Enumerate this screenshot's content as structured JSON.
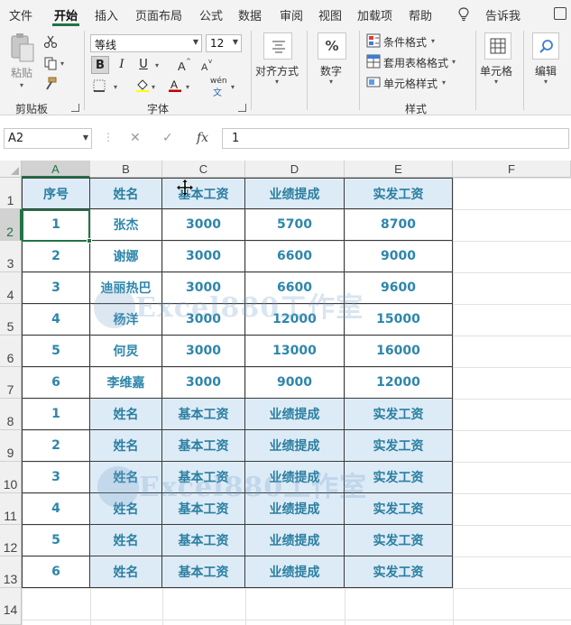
{
  "ribbon_tabs": [
    "文件",
    "开始",
    "插入",
    "页面布局",
    "公式",
    "数据",
    "审阅",
    "视图",
    "加载项",
    "帮助"
  ],
  "tell_me": "告诉我",
  "clipboard": {
    "paste_label": "粘贴",
    "group_label": "剪贴板"
  },
  "font": {
    "name": "等线",
    "size": "12",
    "group_label": "字体",
    "bold": "B",
    "italic": "I",
    "underline": "U",
    "phonetic": "wén"
  },
  "alignment": {
    "label": "对齐方式"
  },
  "number": {
    "label": "数字",
    "symbol": "%"
  },
  "styles": {
    "conditional": "条件格式",
    "table": "套用表格格式",
    "cell_styles": "单元格样式",
    "group_label": "样式"
  },
  "cells": {
    "label": "单元格"
  },
  "editing": {
    "label": "编辑"
  },
  "formula_bar": {
    "name_box": "A2",
    "value": "1",
    "fx": "fx"
  },
  "columns": [
    "A",
    "B",
    "C",
    "D",
    "E",
    "F"
  ],
  "rows": [
    "1",
    "2",
    "3",
    "4",
    "5",
    "6",
    "7",
    "8",
    "9",
    "10",
    "11",
    "12",
    "13",
    "14"
  ],
  "sheet": {
    "header": [
      "序号",
      "姓名",
      "基本工资",
      "业绩提成",
      "实发工资"
    ],
    "data": [
      [
        "1",
        "张杰",
        "3000",
        "5700",
        "8700"
      ],
      [
        "2",
        "谢娜",
        "3000",
        "6600",
        "9000"
      ],
      [
        "3",
        "迪丽热巴",
        "3000",
        "6600",
        "9600"
      ],
      [
        "4",
        "杨洋",
        "3000",
        "12000",
        "15000"
      ],
      [
        "5",
        "何炅",
        "3000",
        "13000",
        "16000"
      ],
      [
        "6",
        "李维嘉",
        "3000",
        "9000",
        "12000"
      ]
    ],
    "repeat_rows": [
      [
        "1",
        "姓名",
        "基本工资",
        "业绩提成",
        "实发工资"
      ],
      [
        "2",
        "姓名",
        "基本工资",
        "业绩提成",
        "实发工资"
      ],
      [
        "3",
        "姓名",
        "基本工资",
        "业绩提成",
        "实发工资"
      ],
      [
        "4",
        "姓名",
        "基本工资",
        "业绩提成",
        "实发工资"
      ],
      [
        "5",
        "姓名",
        "基本工资",
        "业绩提成",
        "实发工资"
      ],
      [
        "6",
        "姓名",
        "基本工资",
        "业绩提成",
        "实发工资"
      ]
    ]
  },
  "watermark": "Excel880工作室",
  "colors": {
    "accent": "#217346",
    "cell_text": "#2e86ab",
    "shade": "#ddebf7"
  }
}
